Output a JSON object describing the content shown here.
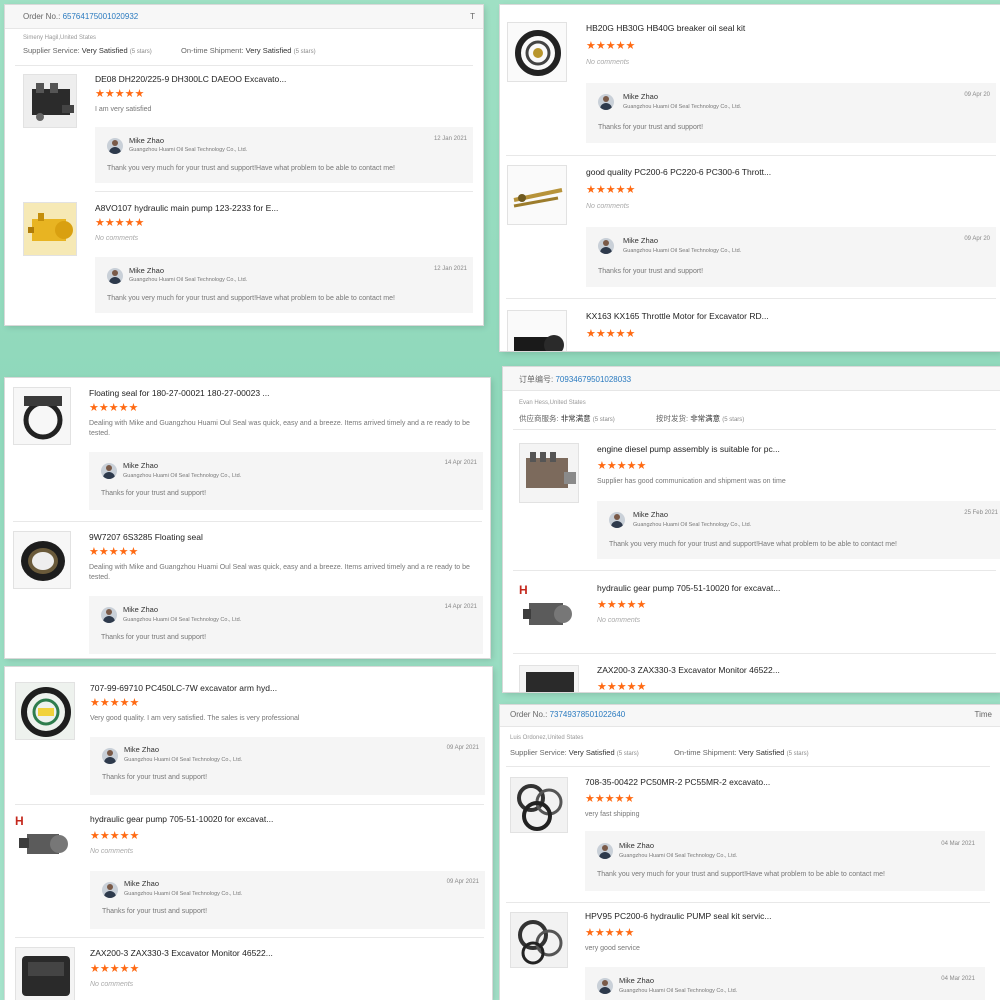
{
  "colors": {
    "star": "#ff6a13",
    "order_link": "#2a7abf",
    "background": "#9fe0c4"
  },
  "star_glyphs": "★★★★★",
  "reply": {
    "name": "Mike Zhao",
    "company": "Guangzhou Huami Oil Seal Technology Co., Ltd.",
    "text_long": "Thank you very much for your trust and support!Have what problem to be able to contact me!",
    "text_short": "Thanks for your trust and support!"
  },
  "panel1": {
    "order_label": "Order No.:",
    "order_no": "65764175001020932",
    "corner": "T",
    "buyer": "Simeny Hagil,United States",
    "supplier_label": "Supplier Service:",
    "supplier_val": "Very Satisfied",
    "supplier_stars": "(5 stars)",
    "ontime_label": "On-time Shipment:",
    "ontime_val": "Very Satisfied",
    "ontime_stars": "(5 stars)",
    "items": [
      {
        "title": "DE08 DH220/225-9 DH300LC DAEOO Excavato...",
        "comment": "I am very satisfied",
        "date": "12 Jan 2021"
      },
      {
        "title": "A8VO107 hydraulic main pump 123-2233 for E...",
        "comment": "No comments",
        "date": "12 Jan 2021"
      }
    ]
  },
  "panel2": {
    "items": [
      {
        "title": "HB20G HB30G HB40G breaker oil seal kit",
        "comment": "No comments",
        "date": "09 Apr 20"
      },
      {
        "title": "good quality PC200-6 PC220-6 PC300-6 Thrott...",
        "comment": "No comments",
        "date": "09 Apr 20"
      },
      {
        "title": "KX163 KX165 Throttle Motor for Excavator RD..."
      }
    ]
  },
  "panel3": {
    "items": [
      {
        "title": "Floating seal for 180-27-00021 180-27-00023 ...",
        "comment": "Dealing with Mike and Guangzhou Huami Oul Seal was quick, easy and a breeze. Items arrived timely and a re ready to be tested.",
        "date": "14 Apr 2021"
      },
      {
        "title": "9W7207 6S3285 Floating seal",
        "comment": "Dealing with Mike and Guangzhou Huami Oul Seal was quick, easy and a breeze. Items arrived timely and a re ready to be tested.",
        "date": "14 Apr 2021"
      }
    ]
  },
  "panel4": {
    "order_label": "订单编号:",
    "order_no": "70934679501028033",
    "buyer": "Evan Hess,United States",
    "supplier_label": "供应商服务:",
    "supplier_val": "非常满意",
    "supplier_stars": "(5 stars)",
    "ontime_label": "按时发货:",
    "ontime_val": "非常满意",
    "ontime_stars": "(5 stars)",
    "items": [
      {
        "title": "engine diesel pump assembly is suitable for pc...",
        "comment": "Supplier has good communication and shipment was on time",
        "date": "25 Feb 2021"
      },
      {
        "title": "hydraulic gear pump 705-51-10020 for excavat...",
        "comment": "No comments"
      },
      {
        "title": "ZAX200-3 ZAX330-3 Excavator Monitor 46522..."
      }
    ]
  },
  "panel5": {
    "items": [
      {
        "title": "707-99-69710 PC450LC-7W excavator arm hyd...",
        "comment": "Very good quality. I am very satisfied. The sales is very professional",
        "date": "09 Apr 2021"
      },
      {
        "title": "hydraulic gear pump 705-51-10020 for excavat...",
        "comment": "No comments",
        "date": "09 Apr 2021"
      },
      {
        "title": "ZAX200-3 ZAX330-3 Excavator Monitor 46522...",
        "comment": "No comments"
      }
    ]
  },
  "panel6": {
    "order_label": "Order No.:",
    "order_no": "73749378501022640",
    "corner": "Time",
    "buyer": "Luis Ordonez,United States",
    "supplier_label": "Supplier Service:",
    "supplier_val": "Very Satisfied",
    "supplier_stars": "(5 stars)",
    "ontime_label": "On-time Shipment:",
    "ontime_val": "Very Satisfied",
    "ontime_stars": "(5 stars)",
    "items": [
      {
        "title": "708-35-00422 PC50MR-2 PC55MR-2 excavato...",
        "comment": "very fast shipping",
        "date": "04 Mar 2021"
      },
      {
        "title": "HPV95 PC200-6 hydraulic PUMP seal kit servic...",
        "comment": "very good service",
        "date": "04 Mar 2021"
      }
    ]
  }
}
